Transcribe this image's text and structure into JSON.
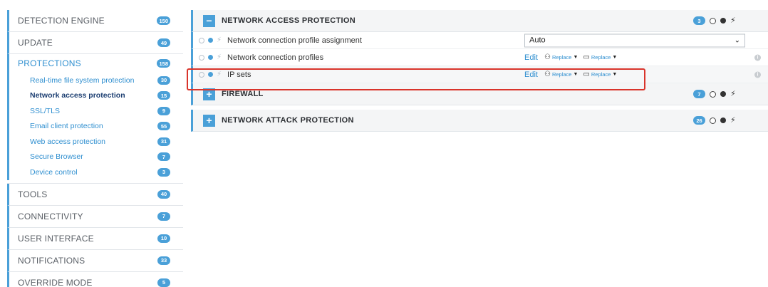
{
  "sidebar": {
    "detection_engine": {
      "label": "DETECTION ENGINE",
      "count": "150"
    },
    "update": {
      "label": "UPDATE",
      "count": "49"
    },
    "protections": {
      "label": "PROTECTIONS",
      "count": "158"
    },
    "sub": [
      {
        "label": "Real-time file system protection",
        "count": "30"
      },
      {
        "label": "Network access protection",
        "count": "15"
      },
      {
        "label": "SSL/TLS",
        "count": "9"
      },
      {
        "label": "Email client protection",
        "count": "55"
      },
      {
        "label": "Web access protection",
        "count": "31"
      },
      {
        "label": "Secure Browser",
        "count": "7"
      },
      {
        "label": "Device control",
        "count": "3"
      }
    ],
    "tools": {
      "label": "TOOLS",
      "count": "40"
    },
    "connectivity": {
      "label": "CONNECTIVITY",
      "count": "7"
    },
    "user_interface": {
      "label": "USER INTERFACE",
      "count": "10"
    },
    "notifications": {
      "label": "NOTIFICATIONS",
      "count": "33"
    },
    "override_mode": {
      "label": "OVERRIDE MODE",
      "count": "5"
    }
  },
  "main": {
    "network_access": {
      "title": "NETWORK ACCESS PROTECTION",
      "count": "3",
      "toggle": "−"
    },
    "rows": {
      "profile_assignment": {
        "label": "Network connection profile assignment",
        "value": "Auto"
      },
      "profiles": {
        "label": "Network connection profiles",
        "edit": "Edit",
        "replace1": "Replace",
        "replace2": "Replace"
      },
      "ip_sets": {
        "label": "IP sets",
        "edit": "Edit",
        "replace1": "Replace",
        "replace2": "Replace"
      }
    },
    "firewall": {
      "title": "FIREWALL",
      "count": "7",
      "toggle": "+"
    },
    "network_attack": {
      "title": "NETWORK ATTACK PROTECTION",
      "count": "26",
      "toggle": "+"
    }
  },
  "icons": {
    "bolt": "⚡",
    "caret": "⌄",
    "info": "i"
  },
  "colors": {
    "accent": "#4aa0d8",
    "highlight": "#d9342b",
    "link": "#2f8fd0"
  }
}
